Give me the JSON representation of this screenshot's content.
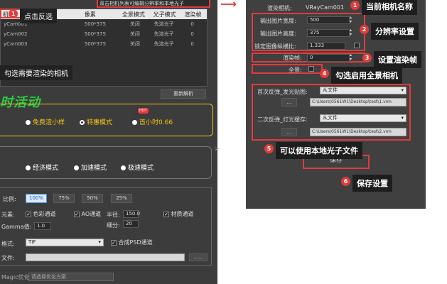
{
  "left": {
    "header_note": "双击相机列表可编辑分辨率和本地光子",
    "columns": [
      "机",
      "像素",
      "全景模式",
      "光子模式",
      "渲染帧"
    ],
    "rows": [
      [
        "yCam001",
        "500*375",
        "关闭",
        "先渲光子",
        "0"
      ],
      [
        "yCam002",
        "500*375",
        "关闭",
        "先渲光子",
        "0"
      ],
      [
        "yCam003",
        "500*375",
        "关闭",
        "先渲光子",
        "0"
      ]
    ],
    "callout1_badge": "1",
    "callout1_text": "点击反选",
    "callout2_text": "勾选需要渲染的相机",
    "reparse_button": "重新解析",
    "promo_title": "时活动",
    "promo_options": [
      "免费渲小样",
      "特惠模式",
      "首小时0.66"
    ],
    "hot_label": "HOT",
    "modes": [
      "经济模式",
      "加速模式",
      "极速模式"
    ],
    "scale_label": "比例:",
    "scale_options": [
      "100%",
      "75%",
      "50%",
      "25%"
    ],
    "elements_label": "元素:",
    "color_channel": "色彩通道",
    "ao_channel": "AO通道",
    "radius_label": "半径:",
    "radius_value": "150.0",
    "material_channel": "材质通道",
    "gamma_label": "Gamma值:",
    "gamma_value": "1.0",
    "subdiv_label": "细分:",
    "subdiv_value": "20",
    "format_label": "格式:",
    "format_value": "TIF",
    "psd_label": "合成PSD通道",
    "file_label": "文件:",
    "browse": "......",
    "magic_label": "Magic优化",
    "magic_placeholder": "请选择优化方案",
    "collapse_arrow": ">"
  },
  "right": {
    "camera_label": "渲染相机:",
    "camera_value": "VRayCam001",
    "width_label": "输出图片宽度:",
    "width_value": "500",
    "height_label": "输出图片高度:",
    "height_value": "375",
    "lock_label": "锁定图像纵横比:",
    "lock_value": "1.333",
    "frame_label": "渲染帧:",
    "frame_value": "0",
    "pano_label": "全景:",
    "first_bounce_label": "首次反弹_发光贴图:",
    "first_bounce_value": "从文件",
    "first_path": "C:\\Users\\0561W1\\Desktop\\test\\1.vrm",
    "second_bounce_label": "二次反弹_灯光缓存:",
    "second_bounce_value": "从文件",
    "second_path": "C:\\Users\\0561W1\\Desktop\\test\\2.vrm",
    "browse": "...",
    "save_button": "保存"
  },
  "callouts": [
    {
      "n": "1",
      "text": "当前相机名称"
    },
    {
      "n": "2",
      "text": "分辨率设置"
    },
    {
      "n": "3",
      "text": "设置渲染帧"
    },
    {
      "n": "4",
      "text": "勾选启用全景相机"
    },
    {
      "n": "5",
      "text": "可以使用本地光子文件"
    },
    {
      "n": "6",
      "text": "保存设置"
    }
  ],
  "colors": {
    "accent_red": "#e23b3b",
    "promo_green": "#2ecc40",
    "promo_yellow": "#f5c518",
    "panel": "#3c3c3c"
  }
}
